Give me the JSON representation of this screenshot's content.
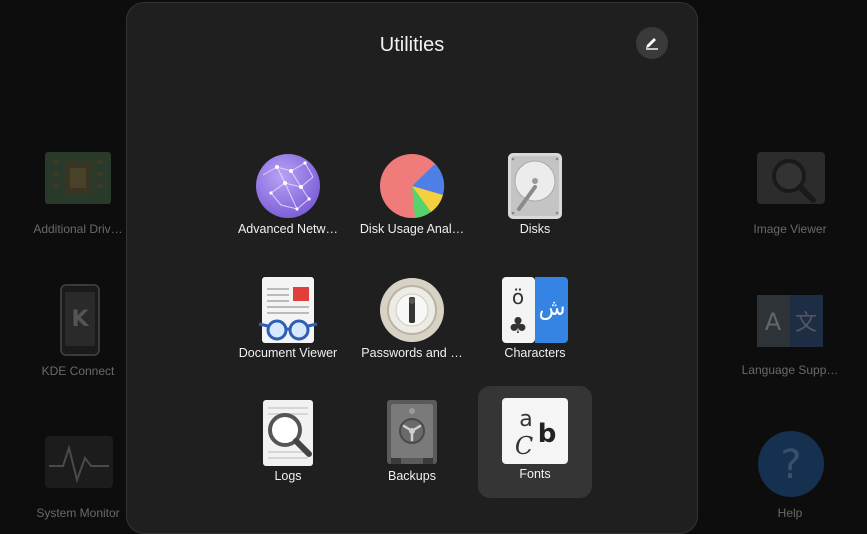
{
  "folder": {
    "title": "Utilities",
    "apps": [
      {
        "label": "Advanced Netw…",
        "icon": "network-globe-icon"
      },
      {
        "label": "Disk Usage Anal…",
        "icon": "pie-chart-icon"
      },
      {
        "label": "Disks",
        "icon": "hard-drive-icon"
      },
      {
        "label": "Document Viewer",
        "icon": "document-viewer-icon"
      },
      {
        "label": "Passwords and …",
        "icon": "padlock-icon"
      },
      {
        "label": "Characters",
        "icon": "characters-icon"
      },
      {
        "label": "Logs",
        "icon": "magnifier-icon"
      },
      {
        "label": "Backups",
        "icon": "safe-icon"
      },
      {
        "label": "Fonts",
        "icon": "fonts-icon"
      }
    ],
    "selected_app": "Fonts",
    "characters_glyphs": {
      "latin": "ö",
      "arabic": "ش",
      "club": "♣"
    },
    "fonts_glyphs": {
      "a": "a",
      "c": "C",
      "b": "b"
    }
  },
  "background_apps": [
    {
      "label": "Additional Driv…",
      "icon": "chip-icon"
    },
    {
      "label": "KDE Connect",
      "icon": "kde-phone-icon"
    },
    {
      "label": "System Monitor",
      "icon": "system-monitor-icon"
    },
    {
      "label": "Image Viewer",
      "icon": "image-viewer-icon"
    },
    {
      "label": "Language Supp…",
      "icon": "language-icon"
    },
    {
      "label": "Help",
      "icon": "help-icon"
    }
  ],
  "background_glyphs": {
    "lang_a": "A",
    "lang_b": "文",
    "help": "?",
    "kde": "K"
  },
  "colors": {
    "folder_bg": "#1f1f1f",
    "selected_tile": "#353535",
    "desktop_bg": "#0d0d0d"
  }
}
